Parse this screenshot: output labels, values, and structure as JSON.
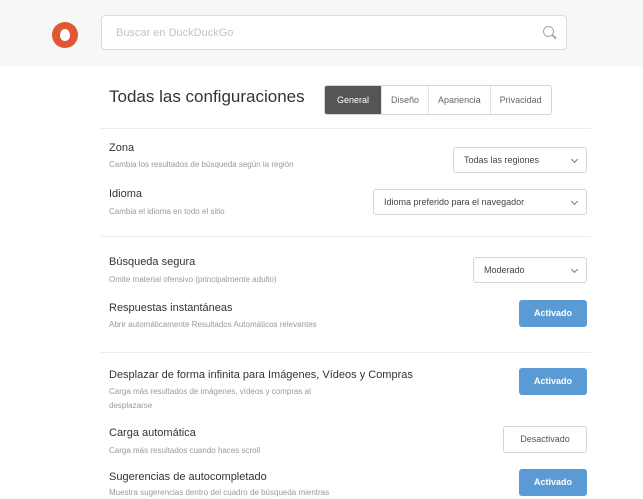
{
  "header": {
    "search_placeholder": "Buscar en DuckDuckGo"
  },
  "page": {
    "title": "Todas las configuraciones",
    "tabs": [
      {
        "label": "General",
        "active": true
      },
      {
        "label": "Diseño",
        "active": false
      },
      {
        "label": "Apariencia",
        "active": false
      },
      {
        "label": "Privacidad",
        "active": false
      }
    ]
  },
  "settings": {
    "region": {
      "title": "Zona",
      "desc": "Cambia los resultados de búsqueda según la región",
      "value": "Todas las regiones"
    },
    "language": {
      "title": "Idioma",
      "desc": "Cambia el idioma en todo el sitio",
      "value": "Idioma preferido para el navegador"
    },
    "safe_search": {
      "title": "Búsqueda segura",
      "desc": "Omite material ofensivo (principalmente adulto)",
      "value": "Moderado"
    },
    "instant_answers": {
      "title": "Respuestas instantáneas",
      "desc": "Abrir automáticamente Resultados Automáticos relevantes",
      "value": "Activado"
    },
    "infinite_scroll": {
      "title": "Desplazar de forma infinita para Imágenes, Vídeos y Compras",
      "desc_line1": "Carga más resultados de imágenes, vídeos y compras al",
      "desc_line2": "desplazarse",
      "value": "Activado"
    },
    "auto_load": {
      "title": "Carga automática",
      "desc": "Carga más resultados cuando haces scroll",
      "value": "Desactivado"
    },
    "autocomplete": {
      "title": "Sugerencias de autocompletado",
      "desc": "Muestra sugerencias dentro del cuadro de búsqueda mientras",
      "value": "Activado"
    }
  },
  "colors": {
    "accent": "#5b9bd5",
    "active_tab": "#555555",
    "logo": "#de5833"
  }
}
